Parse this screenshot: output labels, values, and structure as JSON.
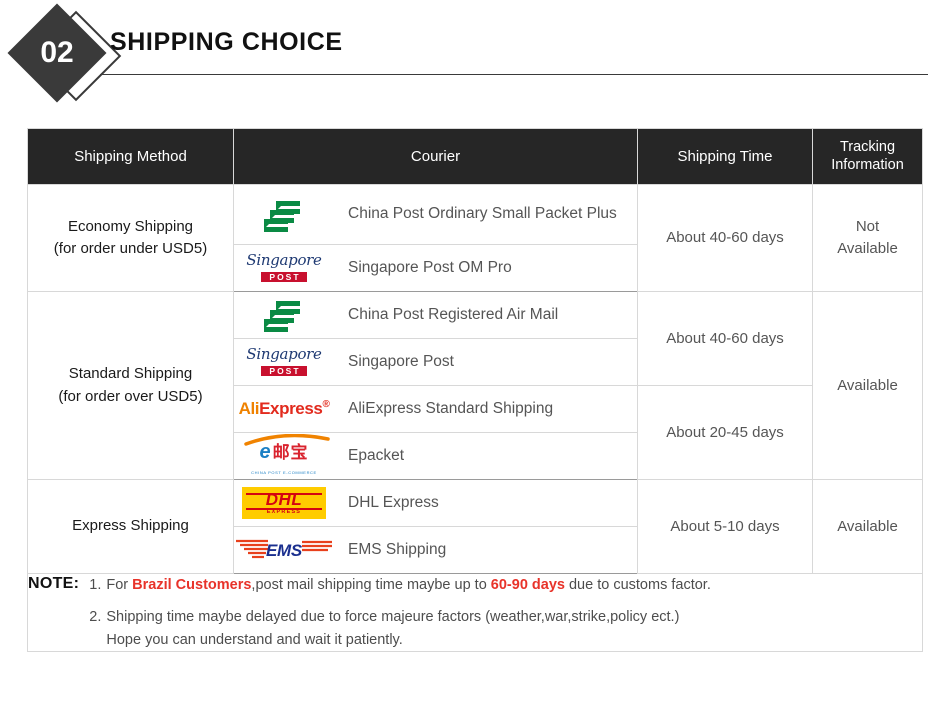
{
  "section": {
    "number": "02",
    "title": "SHIPPING CHOICE"
  },
  "table": {
    "headers": {
      "method": "Shipping Method",
      "courier": "Courier",
      "time": "Shipping Time",
      "tracking_line1": "Tracking",
      "tracking_line2": "Information"
    },
    "groups": [
      {
        "method_line1": "Economy Shipping",
        "method_line2": "(for order under USD5)",
        "tracking": "Not\nAvailable",
        "tracking_line1": "Not",
        "tracking_line2": "Available",
        "couriers": [
          {
            "logo": "china-post-logo",
            "name": "China Post Ordinary Small Packet Plus"
          },
          {
            "logo": "singapore-post-logo",
            "name": "Singapore Post OM Pro"
          }
        ],
        "times": [
          {
            "label": "About 40-60 days",
            "rows": 2
          }
        ]
      },
      {
        "method_line1": "Standard Shipping",
        "method_line2": "(for order over USD5)",
        "tracking_line1": "Available",
        "tracking_line2": "",
        "couriers": [
          {
            "logo": "china-post-logo",
            "name": "China Post Registered Air Mail"
          },
          {
            "logo": "singapore-post-logo",
            "name": "Singapore Post"
          },
          {
            "logo": "aliexpress-logo",
            "name": "AliExpress Standard Shipping"
          },
          {
            "logo": "epacket-logo",
            "name": "Epacket"
          }
        ],
        "times": [
          {
            "label": "About 40-60 days",
            "rows": 2
          },
          {
            "label": "About 20-45 days",
            "rows": 2
          }
        ]
      },
      {
        "method_line1": "Express Shipping",
        "method_line2": "",
        "tracking_line1": "Available",
        "tracking_line2": "",
        "couriers": [
          {
            "logo": "dhl-logo",
            "name": "DHL Express"
          },
          {
            "logo": "ems-logo",
            "name": "EMS Shipping"
          }
        ],
        "times": [
          {
            "label": "About 5-10 days",
            "rows": 2
          }
        ]
      }
    ]
  },
  "note": {
    "label": "NOTE:",
    "items": [
      {
        "number": "1.",
        "part1": "For ",
        "highlight1": "Brazil Customers",
        "part2": ",post mail shipping time maybe up to ",
        "highlight2": "60-90 days",
        "part3": " due to customs factor."
      },
      {
        "number": "2.",
        "line1": "Shipping time maybe delayed due to force majeure factors (weather,war,strike,policy ect.)",
        "line2": "Hope you can understand and wait it patiently."
      }
    ]
  },
  "logos": {
    "china_post": {
      "name": "China Post",
      "color": "#0a8a44"
    },
    "singapore_post": {
      "script": "Singapore",
      "box": "POST",
      "script_color": "#1f3a73",
      "box_color": "#c8102e"
    },
    "aliexpress": {
      "part1": "Ali",
      "part2": "Express",
      "mark": "®",
      "color1": "#ef8200",
      "color2": "#e22b1e"
    },
    "epacket": {
      "e": "e",
      "cn": "邮宝",
      "sub": "CHINA POST E-COMMERCE",
      "color_e": "#1b7fc4",
      "color_cn": "#d9232e"
    },
    "dhl": {
      "text": "DHL",
      "sub": "EXPRESS",
      "bg": "#ffcc00",
      "fg": "#d40511"
    },
    "ems": {
      "text": "EMS",
      "color": "#1a2f8f",
      "stripe": "#e8401c"
    }
  }
}
